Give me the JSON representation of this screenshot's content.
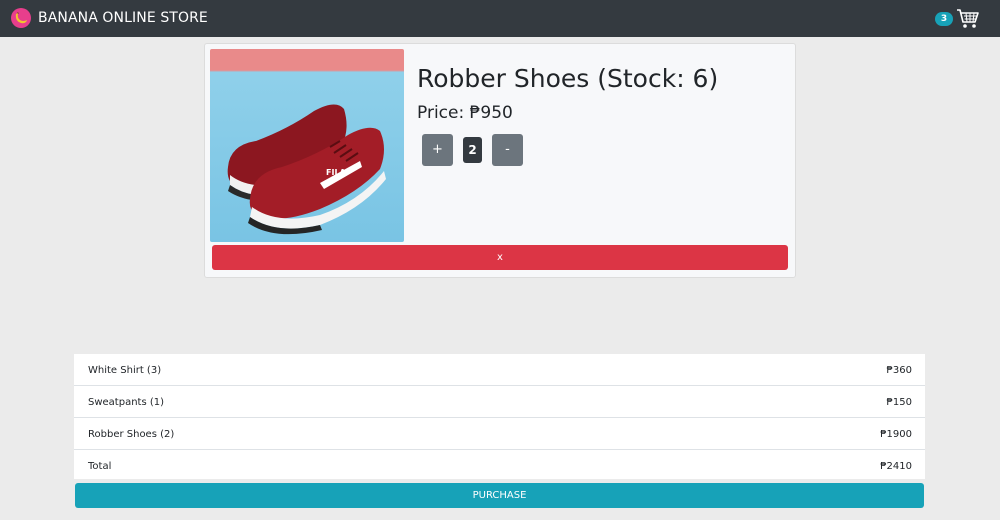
{
  "navbar": {
    "brand": "BANANA ONLINE STORE",
    "logo_icon": "banana-icon",
    "cart_icon": "shopping-cart-icon",
    "cart_count": "3"
  },
  "product": {
    "title": "Robber Shoes (Stock: 6)",
    "price": "Price: ₱950",
    "image_icon": "red-sneakers-image",
    "plus_label": "+",
    "quantity": "2",
    "minus_label": "-",
    "remove_label": "x"
  },
  "summary": {
    "rows": [
      {
        "name": "White Shirt (3)",
        "amount": "₱360"
      },
      {
        "name": "Sweatpants (1)",
        "amount": "₱150"
      },
      {
        "name": "Robber Shoes (2)",
        "amount": "₱1900"
      }
    ],
    "total_label": "Total",
    "total_amount": "₱2410",
    "purchase_label": "PURCHASE"
  },
  "colors": {
    "navbar": "#343a40",
    "danger": "#dc3545",
    "info": "#17a2b8",
    "secondary": "#6c757d",
    "logo": "#e83e8c"
  }
}
